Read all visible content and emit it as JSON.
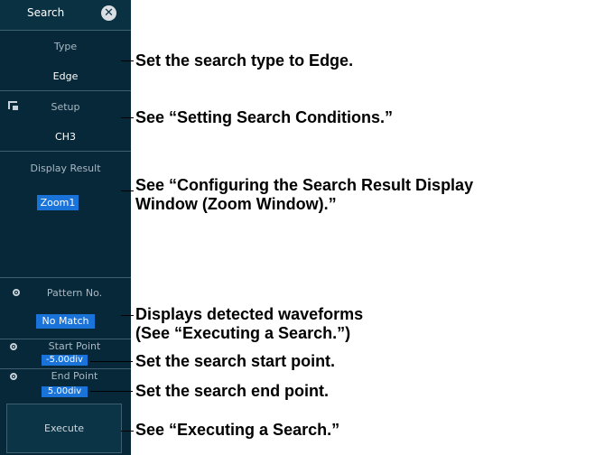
{
  "panel": {
    "title": "Search",
    "type": {
      "label": "Type",
      "value": "Edge"
    },
    "setup": {
      "label": "Setup",
      "value": "CH3"
    },
    "display_result": {
      "label": "Display Result",
      "value": "Zoom1"
    },
    "pattern_no": {
      "label": "Pattern No.",
      "value": "No Match"
    },
    "start_point": {
      "label": "Start Point",
      "value": "-5.00div"
    },
    "end_point": {
      "label": "End Point",
      "value": "5.00div"
    },
    "execute": "Execute"
  },
  "annotations": {
    "type": "Set the search type to Edge.",
    "setup": "See “Setting Search Conditions.”",
    "display_line1": "See “Configuring the Search Result Display",
    "display_line2": "Window (Zoom Window).”",
    "pattern_line1": "Displays detected waveforms",
    "pattern_line2": "(See “Executing a Search.”)",
    "start": "Set the search start point.",
    "end": "Set the search end point.",
    "execute": "See “Executing a Search.”"
  }
}
